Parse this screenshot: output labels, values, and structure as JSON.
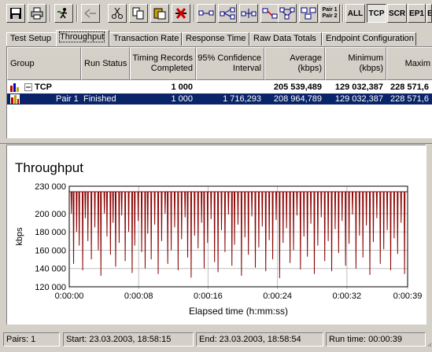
{
  "toolbar": {
    "buttons": [
      {
        "name": "save-icon"
      },
      {
        "name": "print-icon"
      },
      {
        "name": "run-icon"
      },
      {
        "name": "stop-icon"
      },
      {
        "name": "cut-icon"
      },
      {
        "name": "copy-icon"
      },
      {
        "name": "paste-icon"
      },
      {
        "name": "delete-icon"
      },
      {
        "name": "pair-icon"
      },
      {
        "name": "multicast-pair-icon"
      },
      {
        "name": "insert-pair-icon"
      },
      {
        "name": "edit-pair-icon"
      },
      {
        "name": "network-icon"
      },
      {
        "name": "group-icon"
      }
    ],
    "pair_label_1": "Pair 1",
    "pair_label_2": "Pair 2",
    "filter_all": "ALL",
    "filter_tcp": "TCP",
    "filter_scr": "SCR",
    "filter_ep1": "EP1",
    "filter_e": "E"
  },
  "tabs": [
    "Test Setup",
    "Throughput",
    "Transaction Rate",
    "Response Time",
    "Raw Data Totals",
    "Endpoint Configuration"
  ],
  "active_tab": "Throughput",
  "grid": {
    "headers": {
      "group": "Group",
      "run_status": "Run Status",
      "timing_records": [
        "Timing Records",
        "Completed"
      ],
      "confidence": [
        "95% Confidence",
        "Interval"
      ],
      "average": [
        "Average",
        "(kbps)"
      ],
      "minimum": [
        "Minimum",
        "(kbps)"
      ],
      "maximum": "Maxim"
    },
    "group_row": {
      "label": "TCP",
      "timing_records": "1 000",
      "average": "205 539,489",
      "minimum": "129 032,387",
      "maximum": "228 571,6"
    },
    "pair_row": {
      "label": "Pair 1",
      "status": "Finished",
      "timing_records": "1 000",
      "confidence": "1 716,293",
      "average": "208 964,789",
      "minimum": "129 032,387",
      "maximum": "228 571,6"
    }
  },
  "chart_data": {
    "type": "line",
    "title": "Throughput",
    "xlabel": "Elapsed time (h:mm:ss)",
    "ylabel": "kbps",
    "x_ticks": [
      "0:00:00",
      "0:00:08",
      "0:00:16",
      "0:00:24",
      "0:00:32",
      "0:00:39"
    ],
    "y_ticks": [
      "120 000",
      "140 000",
      "160 000",
      "180 000",
      "200 000",
      "230 000"
    ],
    "xlim": [
      0,
      39
    ],
    "ylim": [
      120000,
      230000
    ],
    "grid": true,
    "series_color": "#8b0000",
    "baseline_value": 224000,
    "min_value": 129032,
    "max_value": 228571,
    "dips": [
      [
        0.2,
        200000
      ],
      [
        0.45,
        145000
      ],
      [
        0.8,
        180000
      ],
      [
        1.1,
        165000
      ],
      [
        1.5,
        138000
      ],
      [
        1.8,
        195000
      ],
      [
        2.1,
        170000
      ],
      [
        2.5,
        150000
      ],
      [
        2.9,
        185000
      ],
      [
        3.3,
        160000
      ],
      [
        3.6,
        132000
      ],
      [
        4.0,
        200000
      ],
      [
        4.3,
        175000
      ],
      [
        4.7,
        155000
      ],
      [
        5.0,
        190000
      ],
      [
        5.3,
        142000
      ],
      [
        5.7,
        168000
      ],
      [
        6.0,
        198000
      ],
      [
        6.4,
        148000
      ],
      [
        6.8,
        180000
      ],
      [
        7.2,
        135000
      ],
      [
        7.5,
        165000
      ],
      [
        7.9,
        192000
      ],
      [
        8.3,
        158000
      ],
      [
        8.7,
        140000
      ],
      [
        9.0,
        178000
      ],
      [
        9.4,
        150000
      ],
      [
        9.8,
        188000
      ],
      [
        10.2,
        134000
      ],
      [
        10.6,
        170000
      ],
      [
        11.0,
        200000
      ],
      [
        11.3,
        145000
      ],
      [
        11.7,
        160000
      ],
      [
        12.1,
        185000
      ],
      [
        12.5,
        138000
      ],
      [
        12.9,
        172000
      ],
      [
        13.3,
        196000
      ],
      [
        13.6,
        152000
      ],
      [
        14.0,
        130000
      ],
      [
        14.4,
        176000
      ],
      [
        14.8,
        162000
      ],
      [
        15.2,
        190000
      ],
      [
        15.5,
        140000
      ],
      [
        15.9,
        168000
      ],
      [
        16.3,
        194000
      ],
      [
        16.7,
        147000
      ],
      [
        17.1,
        136000
      ],
      [
        17.5,
        182000
      ],
      [
        17.9,
        158000
      ],
      [
        18.3,
        199000
      ],
      [
        18.7,
        143000
      ],
      [
        19.0,
        166000
      ],
      [
        19.4,
        188000
      ],
      [
        19.8,
        132000
      ],
      [
        20.2,
        174000
      ],
      [
        20.6,
        155000
      ],
      [
        21.0,
        197000
      ],
      [
        21.4,
        141000
      ],
      [
        21.8,
        163000
      ],
      [
        22.2,
        186000
      ],
      [
        22.6,
        137000
      ],
      [
        23.0,
        171000
      ],
      [
        23.4,
        150000
      ],
      [
        23.8,
        193000
      ],
      [
        24.2,
        129500
      ],
      [
        24.6,
        168000
      ],
      [
        25.0,
        184000
      ],
      [
        25.4,
        146000
      ],
      [
        25.8,
        160000
      ],
      [
        26.2,
        198000
      ],
      [
        26.6,
        139000
      ],
      [
        27.0,
        175000
      ],
      [
        27.4,
        153000
      ],
      [
        27.8,
        189000
      ],
      [
        28.2,
        134000
      ],
      [
        28.6,
        165000
      ],
      [
        29.0,
        196000
      ],
      [
        29.4,
        148000
      ],
      [
        29.8,
        170000
      ],
      [
        30.2,
        137000
      ],
      [
        30.6,
        183000
      ],
      [
        31.0,
        157000
      ],
      [
        31.4,
        192000
      ],
      [
        31.8,
        143000
      ],
      [
        32.2,
        167000
      ],
      [
        32.6,
        199000
      ],
      [
        33.0,
        140000
      ],
      [
        33.4,
        176000
      ],
      [
        33.8,
        152000
      ],
      [
        34.2,
        187000
      ],
      [
        34.6,
        133000
      ],
      [
        35.0,
        169000
      ],
      [
        35.4,
        195000
      ],
      [
        35.8,
        145000
      ],
      [
        36.2,
        161000
      ],
      [
        36.6,
        182000
      ],
      [
        37.0,
        138000
      ],
      [
        37.4,
        173000
      ],
      [
        37.8,
        156000
      ],
      [
        38.2,
        190000
      ],
      [
        38.6,
        134000
      ]
    ]
  },
  "status": {
    "pairs": "Pairs: 1",
    "start": "Start: 23.03.2003, 18:58:15",
    "end": "End: 23.03.2003, 18:58:54",
    "run_time": "Run time: 00:00:39"
  }
}
